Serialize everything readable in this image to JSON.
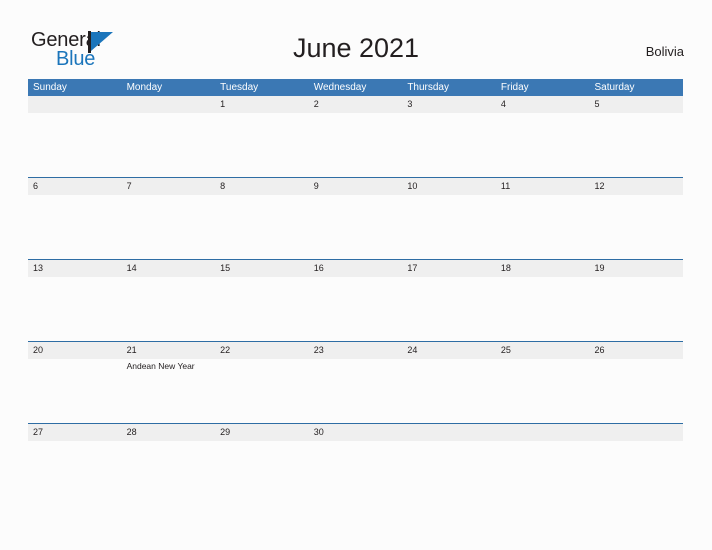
{
  "logo": {
    "word_one": "General",
    "word_two": "Blue",
    "flag_icon": "flag-triangle-icon"
  },
  "header": {
    "title": "June 2021",
    "country": "Bolivia"
  },
  "colors": {
    "header_blue": "#3b78b4",
    "row_divider_blue": "#2e6da4",
    "number_band_gray": "#efefef",
    "logo_blue": "#1b75bb",
    "text_dark": "#231f20",
    "page_background": "#fcfcfc"
  },
  "calendar": {
    "month": "June",
    "year": "2021",
    "day_headers": [
      "Sunday",
      "Monday",
      "Tuesday",
      "Wednesday",
      "Thursday",
      "Friday",
      "Saturday"
    ],
    "weeks": [
      {
        "days": [
          {
            "number": "",
            "events": []
          },
          {
            "number": "",
            "events": []
          },
          {
            "number": "1",
            "events": []
          },
          {
            "number": "2",
            "events": []
          },
          {
            "number": "3",
            "events": []
          },
          {
            "number": "4",
            "events": []
          },
          {
            "number": "5",
            "events": []
          }
        ]
      },
      {
        "days": [
          {
            "number": "6",
            "events": []
          },
          {
            "number": "7",
            "events": []
          },
          {
            "number": "8",
            "events": []
          },
          {
            "number": "9",
            "events": []
          },
          {
            "number": "10",
            "events": []
          },
          {
            "number": "11",
            "events": []
          },
          {
            "number": "12",
            "events": []
          }
        ]
      },
      {
        "days": [
          {
            "number": "13",
            "events": []
          },
          {
            "number": "14",
            "events": []
          },
          {
            "number": "15",
            "events": []
          },
          {
            "number": "16",
            "events": []
          },
          {
            "number": "17",
            "events": []
          },
          {
            "number": "18",
            "events": []
          },
          {
            "number": "19",
            "events": []
          }
        ]
      },
      {
        "days": [
          {
            "number": "20",
            "events": []
          },
          {
            "number": "21",
            "events": [
              "Andean New Year"
            ]
          },
          {
            "number": "22",
            "events": []
          },
          {
            "number": "23",
            "events": []
          },
          {
            "number": "24",
            "events": []
          },
          {
            "number": "25",
            "events": []
          },
          {
            "number": "26",
            "events": []
          }
        ]
      },
      {
        "days": [
          {
            "number": "27",
            "events": []
          },
          {
            "number": "28",
            "events": []
          },
          {
            "number": "29",
            "events": []
          },
          {
            "number": "30",
            "events": []
          },
          {
            "number": "",
            "events": []
          },
          {
            "number": "",
            "events": []
          },
          {
            "number": "",
            "events": []
          }
        ]
      }
    ]
  }
}
